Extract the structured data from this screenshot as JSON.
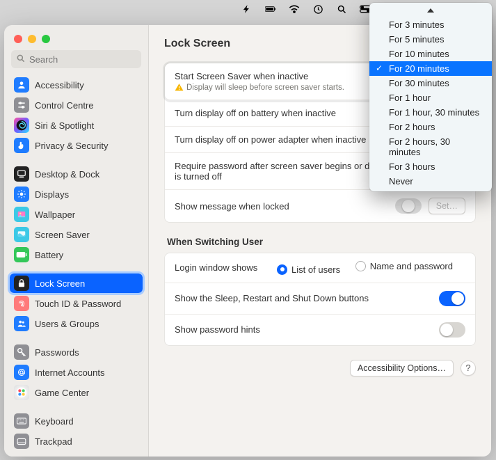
{
  "menubar_icons": [
    "bolt",
    "battery",
    "wifi",
    "clock",
    "search",
    "control"
  ],
  "search": {
    "placeholder": "Search"
  },
  "page_title": "Lock Screen",
  "sidebar": {
    "items": [
      {
        "id": "accessibility",
        "label": "Accessibility",
        "color": "#1f7cff",
        "glyph": "person"
      },
      {
        "id": "control-centre",
        "label": "Control Centre",
        "color": "#8f8f94",
        "glyph": "sliders"
      },
      {
        "id": "siri-spotlight",
        "label": "Siri & Spotlight",
        "color": "grad",
        "glyph": "siri"
      },
      {
        "id": "privacy-security",
        "label": "Privacy & Security",
        "color": "#1f7cff",
        "glyph": "hand"
      },
      {
        "id": "desktop-dock",
        "label": "Desktop & Dock",
        "color": "#222",
        "glyph": "dock"
      },
      {
        "id": "displays",
        "label": "Displays",
        "color": "#1f7cff",
        "glyph": "sun"
      },
      {
        "id": "wallpaper",
        "label": "Wallpaper",
        "color": "#3cc9e6",
        "glyph": "image"
      },
      {
        "id": "screen-saver",
        "label": "Screen Saver",
        "color": "#3cc9e6",
        "glyph": "screensaver"
      },
      {
        "id": "battery",
        "label": "Battery",
        "color": "#34c759",
        "glyph": "battery"
      },
      {
        "id": "lock-screen",
        "label": "Lock Screen",
        "color": "#222",
        "glyph": "lock",
        "selected": true
      },
      {
        "id": "touch-id",
        "label": "Touch ID & Password",
        "color": "#ff7a7a",
        "glyph": "fingerprint"
      },
      {
        "id": "users-groups",
        "label": "Users & Groups",
        "color": "#1f7cff",
        "glyph": "people"
      },
      {
        "id": "passwords",
        "label": "Passwords",
        "color": "#8f8f94",
        "glyph": "key"
      },
      {
        "id": "internet-accounts",
        "label": "Internet Accounts",
        "color": "#1f7cff",
        "glyph": "at"
      },
      {
        "id": "game-center",
        "label": "Game Center",
        "color": "grad2",
        "glyph": "game"
      },
      {
        "id": "keyboard",
        "label": "Keyboard",
        "color": "#8f8f94",
        "glyph": "keyboard"
      },
      {
        "id": "trackpad",
        "label": "Trackpad",
        "color": "#8f8f94",
        "glyph": "trackpad"
      }
    ]
  },
  "rows": {
    "screensaver_label": "Start Screen Saver when inactive",
    "screensaver_warning": "Display will sleep before screen saver starts.",
    "display_off_battery": "Turn display off on battery when inactive",
    "display_off_adapter": "Turn display off on power adapter when inactive",
    "require_password": "Require password after screen saver begins or display is turned off",
    "show_message": "Show message when locked",
    "set_button": "Set…"
  },
  "switching": {
    "heading": "When Switching User",
    "login_window": "Login window shows",
    "opt_list": "List of users",
    "opt_name": "Name and password",
    "show_sleep": "Show the Sleep, Restart and Shut Down buttons",
    "show_hints": "Show password hints"
  },
  "footer": {
    "accessibility_options": "Accessibility Options…"
  },
  "dropdown": {
    "items": [
      {
        "label": "For 3 minutes"
      },
      {
        "label": "For 5 minutes"
      },
      {
        "label": "For 10 minutes"
      },
      {
        "label": "For 20 minutes",
        "selected": true
      },
      {
        "label": "For 30 minutes"
      },
      {
        "label": "For 1 hour"
      },
      {
        "label": "For 1 hour, 30 minutes"
      },
      {
        "label": "For 2 hours"
      },
      {
        "label": "For 2 hours, 30 minutes"
      },
      {
        "label": "For 3 hours"
      },
      {
        "label": "Never"
      }
    ]
  }
}
